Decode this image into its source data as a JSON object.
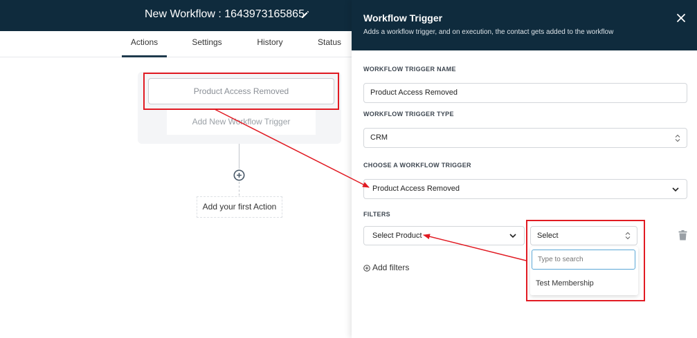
{
  "workflow": {
    "title": "New Workflow : 1643973165865",
    "edit_icon": "pencil-icon"
  },
  "tabs": [
    {
      "label": "Actions",
      "active": true
    },
    {
      "label": "Settings",
      "active": false
    },
    {
      "label": "History",
      "active": false
    },
    {
      "label": "Status",
      "active": false
    }
  ],
  "canvas": {
    "trigger_label": "Product Access Removed",
    "add_trigger_label": "Add New Workflow Trigger",
    "add_action_label": "Add your first Action",
    "add_icon": "plus-circle-icon"
  },
  "drawer": {
    "title": "Workflow Trigger",
    "subtitle": "Adds a workflow trigger, and on execution, the contact gets added to the workflow",
    "close_icon": "close-icon",
    "trigger_name_label": "WORKFLOW TRIGGER NAME",
    "trigger_name_value": "Product Access Removed",
    "trigger_type_label": "WORKFLOW TRIGGER TYPE",
    "trigger_type_value": "CRM",
    "choose_trigger_label": "CHOOSE A WORKFLOW TRIGGER",
    "choose_trigger_value": "Product Access Removed",
    "filters_label": "FILTERS",
    "filter_field_value": "Select Product",
    "filter_value_select": "Select",
    "search_placeholder": "Type to search",
    "options": [
      "Test Membership"
    ],
    "add_filters_label": "Add filters",
    "delete_icon": "trash-icon"
  },
  "colors": {
    "header_bg": "#0f2b3d",
    "annotation": "#e11a22",
    "focus": "#5aa7d6"
  }
}
